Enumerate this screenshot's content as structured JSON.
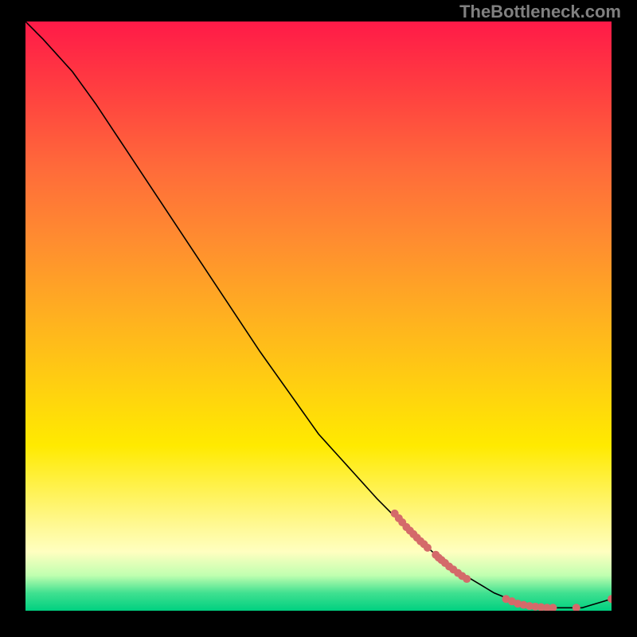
{
  "attribution": "TheBottleneck.com",
  "chart_data": {
    "type": "line",
    "title": "",
    "xlabel": "",
    "ylabel": "",
    "xlim": [
      0,
      100
    ],
    "ylim": [
      0,
      100
    ],
    "curve": [
      {
        "x": 0,
        "y": 100
      },
      {
        "x": 3,
        "y": 97
      },
      {
        "x": 8,
        "y": 91.5
      },
      {
        "x": 12,
        "y": 86
      },
      {
        "x": 20,
        "y": 74
      },
      {
        "x": 30,
        "y": 59
      },
      {
        "x": 40,
        "y": 44
      },
      {
        "x": 50,
        "y": 30
      },
      {
        "x": 60,
        "y": 19
      },
      {
        "x": 65,
        "y": 14
      },
      {
        "x": 70,
        "y": 9.5
      },
      {
        "x": 75,
        "y": 6
      },
      {
        "x": 80,
        "y": 3
      },
      {
        "x": 85,
        "y": 1
      },
      {
        "x": 90,
        "y": 0.5
      },
      {
        "x": 95,
        "y": 0.5
      },
      {
        "x": 100,
        "y": 2
      }
    ],
    "markers": [
      {
        "x": 63,
        "y": 16.5
      },
      {
        "x": 63.7,
        "y": 15.7
      },
      {
        "x": 64.3,
        "y": 15
      },
      {
        "x": 65,
        "y": 14.2
      },
      {
        "x": 65.6,
        "y": 13.6
      },
      {
        "x": 66.2,
        "y": 13
      },
      {
        "x": 66.8,
        "y": 12.4
      },
      {
        "x": 67.4,
        "y": 11.8
      },
      {
        "x": 68,
        "y": 11.3
      },
      {
        "x": 68.6,
        "y": 10.7
      },
      {
        "x": 70,
        "y": 9.5
      },
      {
        "x": 70.5,
        "y": 9
      },
      {
        "x": 71,
        "y": 8.6
      },
      {
        "x": 71.6,
        "y": 8.1
      },
      {
        "x": 72.3,
        "y": 7.5
      },
      {
        "x": 73,
        "y": 7
      },
      {
        "x": 73.8,
        "y": 6.4
      },
      {
        "x": 74.5,
        "y": 5.9
      },
      {
        "x": 75.3,
        "y": 5.4
      },
      {
        "x": 82,
        "y": 2
      },
      {
        "x": 83,
        "y": 1.6
      },
      {
        "x": 84,
        "y": 1.2
      },
      {
        "x": 85,
        "y": 1
      },
      {
        "x": 86,
        "y": 0.8
      },
      {
        "x": 87,
        "y": 0.7
      },
      {
        "x": 88,
        "y": 0.6
      },
      {
        "x": 89,
        "y": 0.5
      },
      {
        "x": 90,
        "y": 0.5
      },
      {
        "x": 94,
        "y": 0.5
      },
      {
        "x": 100,
        "y": 2
      }
    ],
    "marker_color": "#d46a6a"
  }
}
